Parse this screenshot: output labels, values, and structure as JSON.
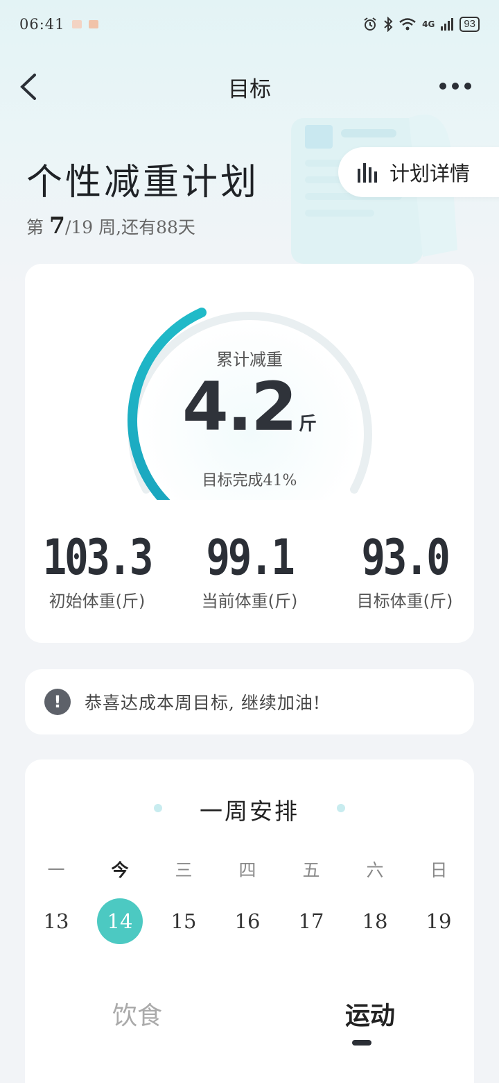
{
  "status_bar": {
    "time": "06:41",
    "battery": "93",
    "network": "4G",
    "icons": [
      "alarm-icon",
      "bluetooth-icon",
      "wifi-icon",
      "signal-icon"
    ]
  },
  "nav": {
    "title": "目标",
    "back_icon": "back-chevron-icon",
    "more_icon": "more-dots-icon"
  },
  "plan": {
    "title": "个性减重计划",
    "week_prefix": "第",
    "week_current": "7",
    "week_total": "/19",
    "week_suffix": "周,还有88天",
    "detail_button": "计划详情",
    "detail_icon": "bar-chart-icon"
  },
  "summary": {
    "gauge_label": "累计减重",
    "gauge_value": "4.2",
    "gauge_unit": "斤",
    "progress_text": "目标完成41%",
    "progress_percent": 41,
    "stats": [
      {
        "value": "103.3",
        "label": "初始体重(斤)"
      },
      {
        "value": "99.1",
        "label": "当前体重(斤)"
      },
      {
        "value": "93.0",
        "label": "目标体重(斤)"
      }
    ]
  },
  "notice": {
    "icon": "exclamation-icon",
    "text": "恭喜达成本周目标, 继续加油!"
  },
  "week": {
    "title": "一周安排",
    "days": [
      {
        "name": "一",
        "date": "13"
      },
      {
        "name": "今",
        "date": "14"
      },
      {
        "name": "三",
        "date": "15"
      },
      {
        "name": "四",
        "date": "16"
      },
      {
        "name": "五",
        "date": "17"
      },
      {
        "name": "六",
        "date": "18"
      },
      {
        "name": "日",
        "date": "19"
      }
    ],
    "tabs": {
      "diet": "饮食",
      "sport": "运动"
    }
  },
  "colors": {
    "accent": "#1fb5c4",
    "today": "#4cc9c2",
    "track": "#e6eef0"
  }
}
